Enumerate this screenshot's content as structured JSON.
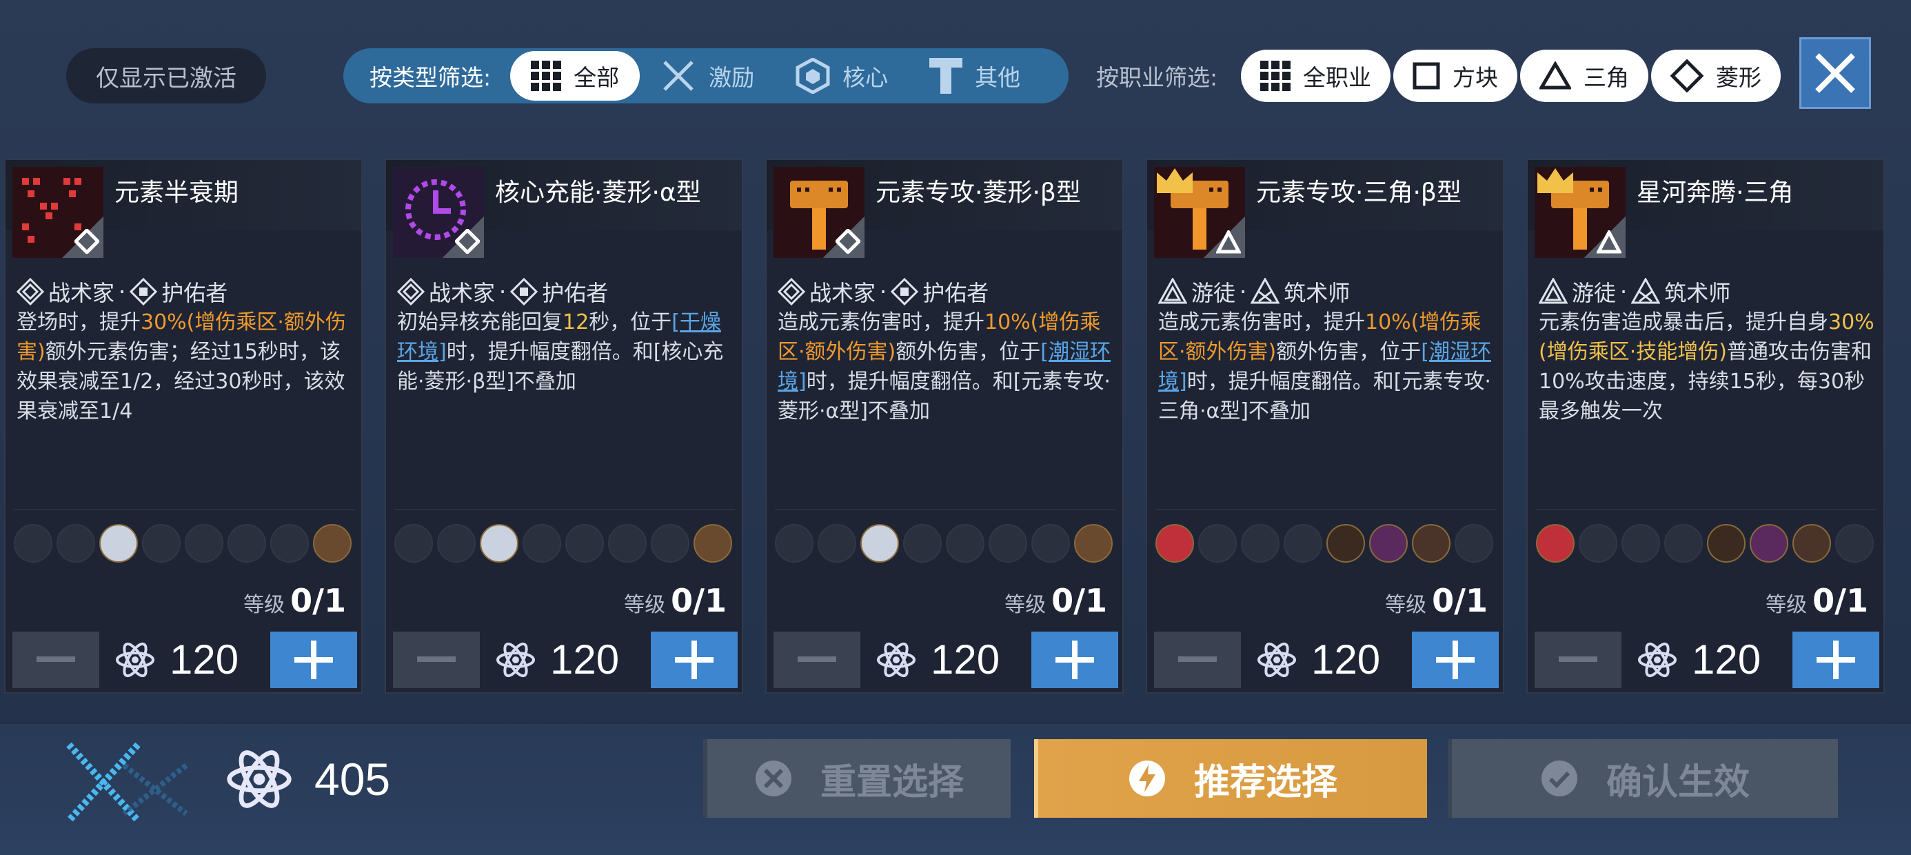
{
  "filters": {
    "only_active": "仅显示已激活",
    "type_label": "按类型筛选:",
    "type_options": [
      "全部",
      "激励",
      "核心",
      "其他"
    ],
    "job_label": "按职业筛选:",
    "job_options": [
      "全职业",
      "方块",
      "三角",
      "菱形"
    ]
  },
  "cards": [
    {
      "title": "元素半衰期",
      "classes": [
        "战术家",
        "护佑者"
      ],
      "desc": [
        "登场时，提升",
        "30%(增伤乘区·额外伤害)",
        "额外元素伤害；经过15秒时，该效果衰减至1/2，经过30秒时，该效果衰减至1/4"
      ],
      "level_label": "等级",
      "level": "0/1",
      "cost": "120"
    },
    {
      "title": "核心充能·菱形·α型",
      "classes": [
        "战术家",
        "护佑者"
      ],
      "desc": [
        "初始异核充能回复",
        "12",
        "秒，位于",
        "[干燥环境]",
        "时，提升幅度翻倍。和[核心充能·菱形·β型]不叠加"
      ],
      "level_label": "等级",
      "level": "0/1",
      "cost": "120"
    },
    {
      "title": "元素专攻·菱形·β型",
      "classes": [
        "战术家",
        "护佑者"
      ],
      "desc": [
        "造成元素伤害时，提升",
        "10%(增伤乘区·额外伤害)",
        "额外伤害，位于",
        "[潮湿环境]",
        "时，提升幅度翻倍。和[元素专攻·菱形·α型]不叠加"
      ],
      "level_label": "等级",
      "level": "0/1",
      "cost": "120"
    },
    {
      "title": "元素专攻·三角·β型",
      "classes": [
        "游徒",
        "筑术师"
      ],
      "desc": [
        "造成元素伤害时，提升",
        "10%(增伤乘区·额外伤害)",
        "额外伤害，位于",
        "[潮湿环境]",
        "时，提升幅度翻倍。和[元素专攻·三角·α型]不叠加"
      ],
      "level_label": "等级",
      "level": "0/1",
      "cost": "120"
    },
    {
      "title": "星河奔腾·三角",
      "classes": [
        "游徒",
        "筑术师"
      ],
      "desc": [
        "元素伤害造成暴击后，提升自身",
        "30%(增伤乘区·技能增伤)",
        "普通攻击伤害和10%攻击速度，持续15秒，每30秒最多触发一次"
      ],
      "level_label": "等级",
      "level": "0/1",
      "cost": "120"
    }
  ],
  "bottom": {
    "total_points": "405",
    "reset_label": "重置选择",
    "recommend_label": "推荐选择",
    "confirm_label": "确认生效"
  },
  "colors": {
    "accent_blue": "#3f86d0",
    "highlight_orange": "#f09a2e",
    "link_blue": "#5aa5e6",
    "recommend_gold": "#e0a34a"
  }
}
